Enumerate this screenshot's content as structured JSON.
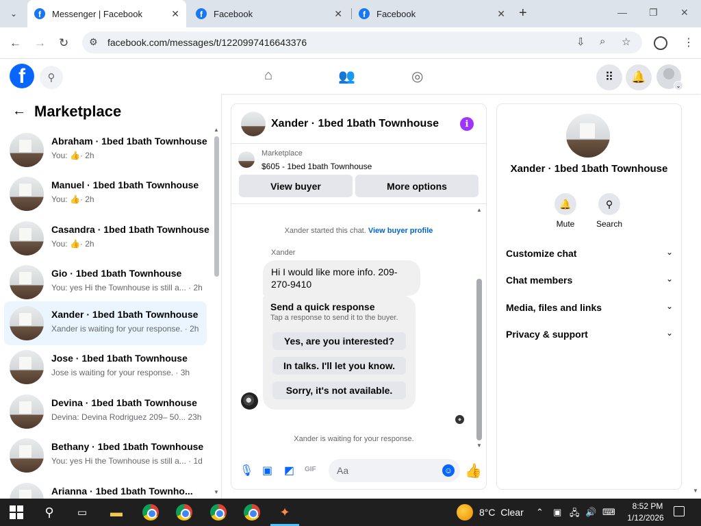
{
  "browser": {
    "tabs": [
      {
        "title": "Messenger | Facebook",
        "active": true
      },
      {
        "title": "Facebook",
        "active": false
      },
      {
        "title": "Facebook",
        "active": false
      }
    ],
    "url": "facebook.com/messages/t/1220997416643376"
  },
  "left_panel": {
    "title": "Marketplace",
    "conversations": [
      {
        "name": "Abraham · 1bed 1bath Townhouse",
        "preview": "You:",
        "like": "👍",
        "time": "· 2h",
        "selected": false
      },
      {
        "name": "Manuel · 1bed 1bath Townhouse",
        "preview": "You:",
        "like": "👍",
        "time": "· 2h",
        "selected": false
      },
      {
        "name": "Casandra · 1bed 1bath Townhouse",
        "preview": "You:",
        "like": "👍",
        "time": "· 2h",
        "selected": false
      },
      {
        "name": "Gio · 1bed 1bath Townhouse",
        "preview": "You: yes Hi the Townhouse is still a...",
        "like": "",
        "time": " · 2h",
        "selected": false
      },
      {
        "name": "Xander · 1bed 1bath Townhouse",
        "preview": "Xander is waiting for your response.",
        "like": "",
        "time": " · 2h",
        "selected": true
      },
      {
        "name": "Jose · 1bed 1bath Townhouse",
        "preview": "Jose is waiting for your response.",
        "like": "",
        "time": " · 3h",
        "selected": false
      },
      {
        "name": "Devina · 1bed 1bath Townhouse",
        "preview": "Devina: Devina Rodriguez 209– 50...",
        "like": "",
        "time": " 23h",
        "selected": false
      },
      {
        "name": "Bethany · 1bed 1bath Townhouse",
        "preview": "You: yes Hi the Townhouse is still a...",
        "like": "",
        "time": " · 1d",
        "selected": false
      },
      {
        "name": "Arianna · 1bed 1bath Townho...",
        "preview": "",
        "like": "",
        "time": "",
        "selected": false
      }
    ]
  },
  "chat": {
    "title": "Xander · 1bed 1bath Townhouse",
    "marketplace_label": "Marketplace",
    "listing": "$605 - 1bed 1bath Townhouse",
    "view_buyer": "View buyer",
    "more_options": "More options",
    "system_text": "Xander started this chat.",
    "system_link": "View buyer profile",
    "sender": "Xander",
    "message": "Hi I would like more info. 209-270-9410",
    "quick_title": "Send a quick response",
    "quick_sub": "Tap a response to send it to the buyer.",
    "quick_responses": [
      "Yes, are you interested?",
      "In talks. I'll let you know.",
      "Sorry, it's not available."
    ],
    "waiting": "Xander is waiting for your response.",
    "composer_placeholder": "Aa"
  },
  "right_panel": {
    "name": "Xander · 1bed 1bath Townhouse",
    "actions": [
      {
        "label": "Mute",
        "icon": "bell-icon"
      },
      {
        "label": "Search",
        "icon": "search-icon"
      }
    ],
    "sections": [
      "Customize chat",
      "Chat members",
      "Media, files and links",
      "Privacy & support"
    ]
  },
  "taskbar": {
    "temperature": "8°C",
    "weather": "Clear",
    "time": "8:52 PM",
    "date": "1/12/2026"
  },
  "colors": {
    "fb_blue": "#0866ff",
    "selected_row": "#ebf5ff",
    "info_purple": "#a033ff"
  }
}
